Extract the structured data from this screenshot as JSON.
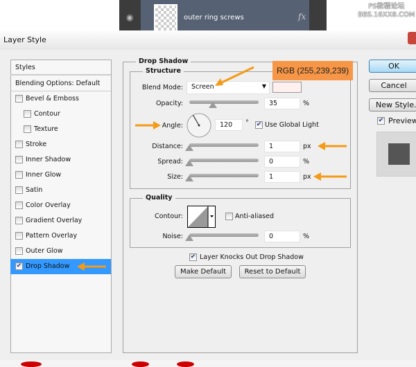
{
  "layers_panel": {
    "layer_name": "outer ring screws",
    "fx_label": "fx"
  },
  "watermark": {
    "line1": "PS教程论坛",
    "line2": "BBS.16XX8.COM"
  },
  "dialog": {
    "title": "Layer Style"
  },
  "sidebar": {
    "header": "Styles",
    "blending": "Blending Options: Default",
    "items": [
      {
        "label": "Bevel & Emboss",
        "checked": false
      },
      {
        "label": "Contour",
        "checked": false
      },
      {
        "label": "Texture",
        "checked": false
      },
      {
        "label": "Stroke",
        "checked": false
      },
      {
        "label": "Inner Shadow",
        "checked": false
      },
      {
        "label": "Inner Glow",
        "checked": false
      },
      {
        "label": "Satin",
        "checked": false
      },
      {
        "label": "Color Overlay",
        "checked": false
      },
      {
        "label": "Gradient Overlay",
        "checked": false
      },
      {
        "label": "Pattern Overlay",
        "checked": false
      },
      {
        "label": "Outer Glow",
        "checked": false
      },
      {
        "label": "Drop Shadow",
        "checked": true,
        "selected": true
      }
    ]
  },
  "drop_shadow": {
    "title": "Drop Shadow",
    "structure": {
      "title": "Structure",
      "blend_mode_label": "Blend Mode:",
      "blend_mode": "Screen",
      "shadow_color": "#ffefef",
      "opacity_label": "Opacity:",
      "opacity": "35",
      "opacity_unit": "%",
      "angle_label": "Angle:",
      "angle": "120",
      "angle_unit": "°",
      "use_global_light": "Use Global Light",
      "distance_label": "Distance:",
      "distance": "1",
      "distance_unit": "px",
      "spread_label": "Spread:",
      "spread": "0",
      "spread_unit": "%",
      "size_label": "Size:",
      "size": "1",
      "size_unit": "px"
    },
    "quality": {
      "title": "Quality",
      "contour_label": "Contour:",
      "anti_aliased": "Anti-aliased",
      "noise_label": "Noise:",
      "noise": "0",
      "noise_unit": "%"
    },
    "knockout": "Layer Knocks Out Drop Shadow",
    "make_default": "Make Default",
    "reset_default": "Reset to Default"
  },
  "buttons": {
    "ok": "OK",
    "cancel": "Cancel",
    "new_style": "New Style...",
    "preview": "Preview"
  },
  "annotation": {
    "rgb_label": "RGB (255,239,239)",
    "color": "#f79646",
    "arrow_color": "#f59a16"
  }
}
